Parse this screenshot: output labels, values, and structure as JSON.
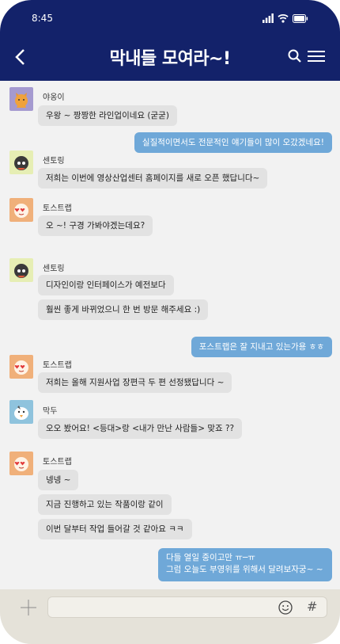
{
  "status": {
    "time": "8:45"
  },
  "header": {
    "title": "막내들 모여라~!"
  },
  "colors": {
    "header": "#13226a",
    "my_bubble": "#6fa8d8",
    "other_bubble": "#e2e2e2"
  },
  "messages": {
    "m1_sender": "야옹이",
    "m1_text": "우왕 ~  짱짱한 라인업이네요 (굳굳)",
    "m2_me": "실질적이면서도 전문적인 얘기들이 많이 오갔겠네요!",
    "m3_sender": "센토링",
    "m3_text": "저희는 이번에 영상산업센터 홈페이지를 새로 오픈 했답니다~",
    "m4_sender": "토스트랩",
    "m4_text": "오 ~! 구경 가봐야겠는데요?",
    "m5_sender": "센토링",
    "m5_text1": "디자인이랑 인터페이스가 예전보다",
    "m5_text2": "훨씬 좋게 바뀌었으니 한 번 방문 해주세요 :)",
    "m6_me": "포스트랩은 잘 지내고 있는가용 ㅎㅎ",
    "m7_sender": "토스트랩",
    "m7_text": "저희는 올해 지원사업 장편극 두 편 선정됐답니다 ~",
    "m8_sender": "막두",
    "m8_text": "오오 봤어요! <등대>랑 <내가 만난 사람들> 맞죠 ??",
    "m9_sender": "토스트랩",
    "m9_text1": "넹넹 ~",
    "m9_text2": "지금 진행하고 있는 작품이랑 같이",
    "m9_text3": "이번 달부터 작업 들어갈 것 같아요 ㅋㅋ",
    "m10_me_line1": "다들 열일 중이고만 ㅠ─ㅠ",
    "m10_me_line2": "그럼 오늘도 부영위를 위해서 달려보자궁~ ~"
  },
  "input": {
    "hash": "#"
  }
}
